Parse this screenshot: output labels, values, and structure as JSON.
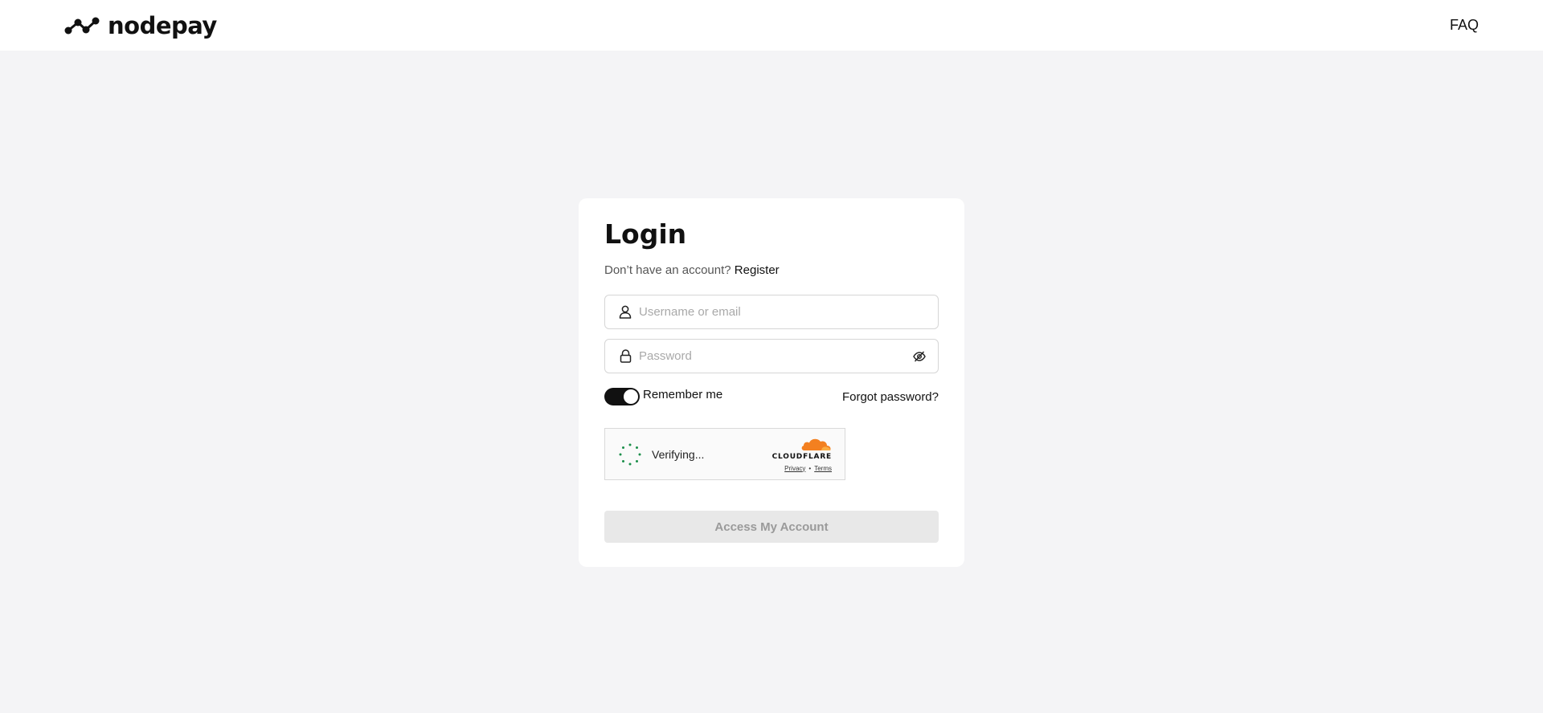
{
  "header": {
    "brand_name": "nodepay",
    "faq_label": "FAQ"
  },
  "login": {
    "title": "Login",
    "no_account_text": "Don’t have an account?",
    "register_label": "Register",
    "username_placeholder": "Username or email",
    "password_placeholder": "Password",
    "remember_label": "Remember me",
    "remember_enabled": true,
    "forgot_label": "Forgot password?",
    "submit_label": "Access My Account"
  },
  "captcha": {
    "status": "Verifying...",
    "provider": "CLOUDFLARE",
    "privacy_label": "Privacy",
    "separator": "•",
    "terms_label": "Terms"
  },
  "colors": {
    "page_bg": "#f4f4f6",
    "cloudflare_orange": "#f38020",
    "spinner_green": "#1c8f4a"
  }
}
